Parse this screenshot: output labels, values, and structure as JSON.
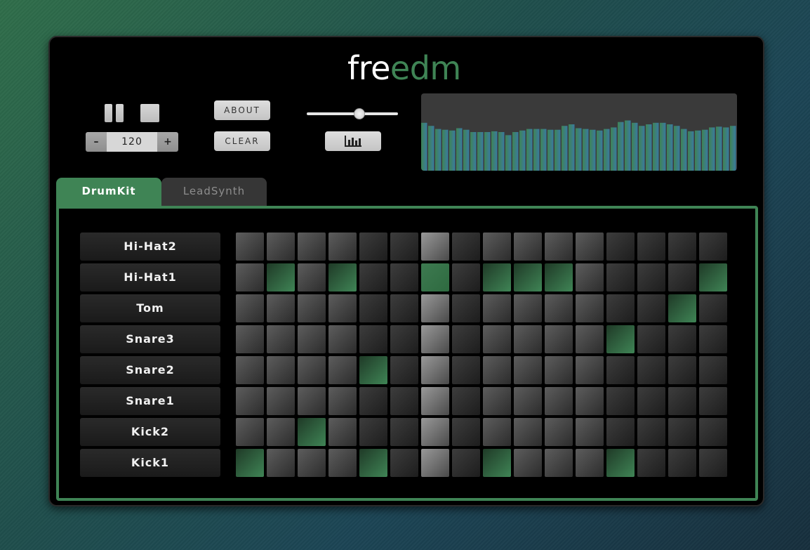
{
  "app": {
    "logo_part1": "fre",
    "logo_part2": "edm",
    "accent_color": "#3f8455"
  },
  "transport": {
    "pause_icon": "pause-icon",
    "stop_icon": "stop-icon",
    "tempo_minus": "–",
    "tempo_value": "120",
    "tempo_plus": "+"
  },
  "buttons": {
    "about_label": "ABOUT",
    "clear_label": "CLEAR",
    "visualizer_icon": "bar-chart-icon"
  },
  "volume": {
    "level": 0.58
  },
  "visualizer": {
    "levels": [
      0.62,
      0.58,
      0.54,
      0.53,
      0.52,
      0.55,
      0.53,
      0.5,
      0.5,
      0.5,
      0.51,
      0.5,
      0.46,
      0.5,
      0.52,
      0.54,
      0.54,
      0.54,
      0.53,
      0.53,
      0.58,
      0.6,
      0.55,
      0.54,
      0.53,
      0.52,
      0.54,
      0.56,
      0.63,
      0.65,
      0.62,
      0.58,
      0.6,
      0.62,
      0.62,
      0.6,
      0.58,
      0.54,
      0.51,
      0.52,
      0.53,
      0.56,
      0.57,
      0.56,
      0.58
    ]
  },
  "tabs": [
    {
      "label": "DrumKit",
      "active": true
    },
    {
      "label": "LeadSynth",
      "active": false
    }
  ],
  "sequencer": {
    "steps": 16,
    "playhead_step": 6,
    "tracks": [
      {
        "name": "Hi-Hat2",
        "pattern": [
          0,
          0,
          0,
          0,
          0,
          0,
          0,
          0,
          0,
          0,
          0,
          0,
          0,
          0,
          0,
          0
        ]
      },
      {
        "name": "Hi-Hat1",
        "pattern": [
          0,
          1,
          0,
          1,
          0,
          0,
          1,
          0,
          1,
          1,
          1,
          0,
          0,
          0,
          0,
          1
        ]
      },
      {
        "name": "Tom",
        "pattern": [
          0,
          0,
          0,
          0,
          0,
          0,
          0,
          0,
          0,
          0,
          0,
          0,
          0,
          0,
          1,
          0
        ]
      },
      {
        "name": "Snare3",
        "pattern": [
          0,
          0,
          0,
          0,
          0,
          0,
          0,
          0,
          0,
          0,
          0,
          0,
          1,
          0,
          0,
          0
        ]
      },
      {
        "name": "Snare2",
        "pattern": [
          0,
          0,
          0,
          0,
          1,
          0,
          0,
          0,
          0,
          0,
          0,
          0,
          0,
          0,
          0,
          0
        ]
      },
      {
        "name": "Snare1",
        "pattern": [
          0,
          0,
          0,
          0,
          0,
          0,
          0,
          0,
          0,
          0,
          0,
          0,
          0,
          0,
          0,
          0
        ]
      },
      {
        "name": "Kick2",
        "pattern": [
          0,
          0,
          1,
          0,
          0,
          0,
          0,
          0,
          0,
          0,
          0,
          0,
          0,
          0,
          0,
          0
        ]
      },
      {
        "name": "Kick1",
        "pattern": [
          1,
          0,
          0,
          0,
          1,
          0,
          0,
          0,
          1,
          0,
          0,
          0,
          1,
          0,
          0,
          0
        ]
      }
    ]
  }
}
